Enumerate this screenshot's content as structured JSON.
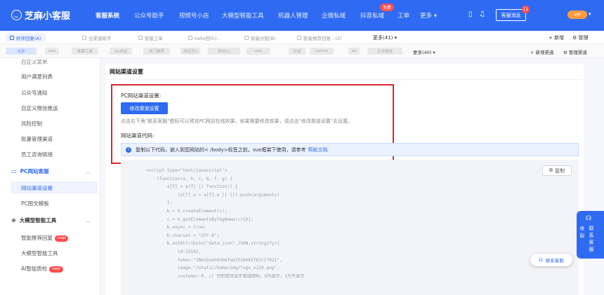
{
  "brand": {
    "name": "芝麻小客服"
  },
  "nav": {
    "items": [
      "客服系统",
      "公众号助手",
      "视频号小店",
      "大模型智能工具",
      "机器人管理",
      "企微私域",
      "抖音私域",
      "工单",
      "更多"
    ],
    "badge": "免费",
    "message_btn": "客服消息",
    "message_count": "11",
    "user_badge": "VIP"
  },
  "tabs1": {
    "items": [
      "好评回复(A)",
      "全渠道助手",
      "智能工单",
      "hello回(h)...",
      "智能分配(B)",
      "智能推荐回复...(2)"
    ],
    "more": "更多(41)",
    "add": "+ 新增",
    "manage": "管理"
  },
  "tabs2": {
    "chips": [
      "全部",
      "aaa",
      "客服工具",
      "Dx测试",
      "热门推荐",
      "测试号1",
      "测试(1)",
      "aaa",
      "对话",
      "lyshua",
      "ab",
      "企业微信"
    ],
    "more": "更多(40)",
    "add": "+ 新增渠道",
    "manage": "管理渠道"
  },
  "sidebar": {
    "items_top": [
      "自定义菜单",
      "用户满意列表",
      "公众号通知",
      "自定义微信推送",
      "风险控制",
      "批量管理渠道",
      "员工咨询链接"
    ],
    "group_pc": "PC网站客服",
    "pc_items": [
      "网站渠道设置",
      "PC图文模板"
    ],
    "group_ai": "大模型智能工具",
    "ai_items": [
      "智能推荐回复",
      "大模型智能工具",
      "AI智能质检"
    ],
    "new_label": "new"
  },
  "panel": {
    "title": "网站渠道设置",
    "pc_label": "PC网站渠道设置:",
    "modify_btn": "修改渠道设置",
    "hint": "点击右下角\"联系客服\"图标可以预览PC网站在线效果，如果需要修改效果，请点击\"修改渠道设置\"去设置。",
    "code_label": "网站渠道代码:",
    "alert_text": "复制以下代码，嵌入到您网站的< /body>标签之前。vue框架下使用，请参考",
    "alert_link": "帮助文档",
    "copy_btn": "复制",
    "code": "<script type=\"text/javascript\">\n    (function(a, h, c, b, f, g) {\n        a[f] = a[f] || function() {\n            (a[f].a = a[f].a || []).push(arguments)\n        };\n        b = h.createElement(c);\n        c = h.getElementsByTagName(c)[0];\n        b.async = true;\n        b.charset = \"UTF-8\";\n        b.setAttribute(\"data-json\",JSON.stringify({\n            id:15502,\n            token:\"ZBm1bueh62b6fad3520005fb7c1f021\",\n            image:\"/static/home/img/logo_n120.png\",\n            customer:0, // 控制是否显示客服图标，0为显示，1为不显示"
  },
  "float": {
    "side_col1": "收起",
    "side_col2": "联系客服",
    "contact_btn": "联系客服"
  }
}
